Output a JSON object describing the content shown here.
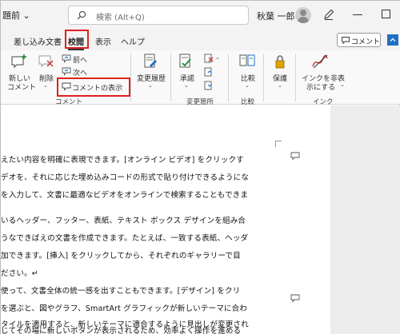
{
  "titlebar": {
    "doc_name": "題前 ⌄",
    "search_placeholder": "検索 (Alt+Q)",
    "user_name": "秋葉 一郎"
  },
  "tabs": [
    {
      "label": "差し込み文書"
    },
    {
      "label": "校閲",
      "active": true
    },
    {
      "label": "表示"
    },
    {
      "label": "ヘルプ"
    }
  ],
  "comment_button": {
    "label": "コメント"
  },
  "ribbon": {
    "new_comment_line1": "新しい",
    "new_comment_line2": "コメント",
    "delete_label": "削除",
    "prev_label": "前へ",
    "next_label": "次へ",
    "show_comments_label": "コメントの表示",
    "comment_group": "コメント",
    "track_changes_line1": "変更履歴",
    "accept_label": "承諾",
    "changes_group": "変更箇所",
    "compare_label": "比較",
    "compare_group": "比較",
    "protect_label": "保護",
    "ink_line1": "インクを非表",
    "ink_line2": "示にする",
    "ink_group": "インク"
  },
  "document": {
    "lines": [
      "えたい内容を明確に表現できます。[オンライン ビデオ] をクリックす",
      "デオを、それに応じた埋め込みコードの形式で貼り付けできるようにな",
      "を入力して、文書に最適なビデオをオンラインで検索することもできま",
      "",
      "いるヘッダー、フッター、表紙、テキスト ボックス デザインを組み合",
      "うなできばえの文書を作成できます。たとえば、一致する表紙、ヘッダ",
      "加できます。[挿入] をクリックしてから、それぞれのギャラリーで目",
      "ださい。↵",
      "使って、文書全体の統一感を出すこともできます。[デザイン] をクリ",
      "を選ぶと、図やグラフ、SmartArt グラフィックが新しいテーマに合わ",
      "タイルを適用すると、新しいテーマに適合するように見出しが変更され",
      "",
      "じてその場に新しいボタンが表示されるため、効率よく操作を進める"
    ]
  },
  "colors": {
    "highlight_box": "#e02020",
    "accent": "#1e6fc4",
    "ink_red": "#d12b2b"
  }
}
